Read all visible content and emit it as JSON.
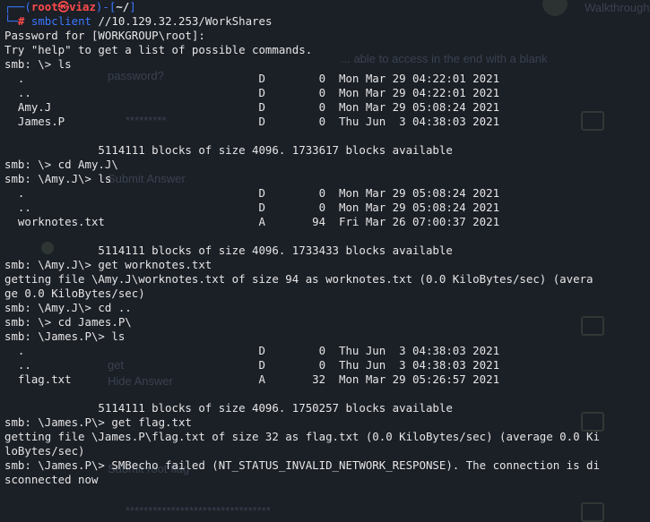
{
  "prompt": {
    "user_host": "root㉿viaz",
    "path": "~/",
    "command": "smbclient",
    "argument": "//10.129.32.253/WorkShares"
  },
  "lines": [
    "Password for [WORKGROUP\\root]:",
    "Try \"help\" to get a list of possible commands.",
    "smb: \\> ls",
    "  .                                   D        0  Mon Mar 29 04:22:01 2021",
    "  ..                                  D        0  Mon Mar 29 04:22:01 2021",
    "  Amy.J                               D        0  Mon Mar 29 05:08:24 2021",
    "  James.P                             D        0  Thu Jun  3 04:38:03 2021",
    "",
    "              5114111 blocks of size 4096. 1733617 blocks available",
    "smb: \\> cd Amy.J\\",
    "smb: \\Amy.J\\> ls",
    "  .                                   D        0  Mon Mar 29 05:08:24 2021",
    "  ..                                  D        0  Mon Mar 29 05:08:24 2021",
    "  worknotes.txt                       A       94  Fri Mar 26 07:00:37 2021",
    "",
    "              5114111 blocks of size 4096. 1733433 blocks available",
    "smb: \\Amy.J\\> get worknotes.txt",
    "getting file \\Amy.J\\worknotes.txt of size 94 as worknotes.txt (0.0 KiloBytes/sec) (avera",
    "ge 0.0 KiloBytes/sec)",
    "smb: \\Amy.J\\> cd ..",
    "smb: \\> cd James.P\\",
    "smb: \\James.P\\> ls",
    "  .                                   D        0  Thu Jun  3 04:38:03 2021",
    "  ..                                  D        0  Thu Jun  3 04:38:03 2021",
    "  flag.txt                            A       32  Mon Mar 29 05:26:57 2021",
    "",
    "              5114111 blocks of size 4096. 1750257 blocks available",
    "smb: \\James.P\\> get flag.txt",
    "getting file \\James.P\\flag.txt of size 32 as flag.txt (0.0 KiloBytes/sec) (average 0.0 Ki",
    "loBytes/sec)",
    "smb: \\James.P\\> SMBecho failed (NT_STATUS_INVALID_NETWORK_RESPONSE). The connection is di",
    "sconnected now"
  ],
  "background": {
    "header_right": "Walkthrough",
    "question_text": "... able to access in the end with a blank",
    "question_text2": "password?",
    "answer_mask": "*********",
    "submit_answer": "Submit Answer",
    "task_get": "get",
    "hide_answer": "Hide Answer",
    "submit_root_flag": "Submit root flag",
    "flag_mask": "********************************"
  }
}
